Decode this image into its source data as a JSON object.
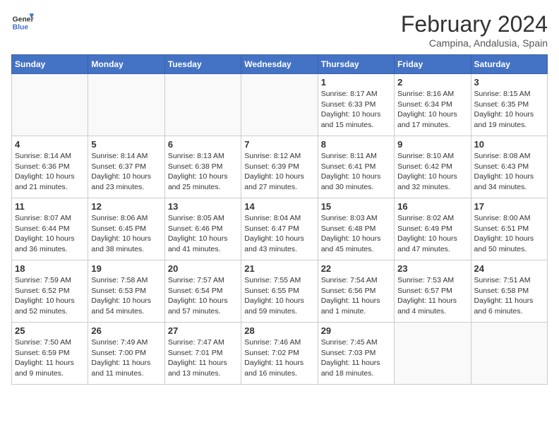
{
  "header": {
    "logo_general": "General",
    "logo_blue": "Blue",
    "month_title": "February 2024",
    "location": "Campina, Andalusia, Spain"
  },
  "weekdays": [
    "Sunday",
    "Monday",
    "Tuesday",
    "Wednesday",
    "Thursday",
    "Friday",
    "Saturday"
  ],
  "weeks": [
    [
      {
        "day": "",
        "info": ""
      },
      {
        "day": "",
        "info": ""
      },
      {
        "day": "",
        "info": ""
      },
      {
        "day": "",
        "info": ""
      },
      {
        "day": "1",
        "info": "Sunrise: 8:17 AM\nSunset: 6:33 PM\nDaylight: 10 hours\nand 15 minutes."
      },
      {
        "day": "2",
        "info": "Sunrise: 8:16 AM\nSunset: 6:34 PM\nDaylight: 10 hours\nand 17 minutes."
      },
      {
        "day": "3",
        "info": "Sunrise: 8:15 AM\nSunset: 6:35 PM\nDaylight: 10 hours\nand 19 minutes."
      }
    ],
    [
      {
        "day": "4",
        "info": "Sunrise: 8:14 AM\nSunset: 6:36 PM\nDaylight: 10 hours\nand 21 minutes."
      },
      {
        "day": "5",
        "info": "Sunrise: 8:14 AM\nSunset: 6:37 PM\nDaylight: 10 hours\nand 23 minutes."
      },
      {
        "day": "6",
        "info": "Sunrise: 8:13 AM\nSunset: 6:38 PM\nDaylight: 10 hours\nand 25 minutes."
      },
      {
        "day": "7",
        "info": "Sunrise: 8:12 AM\nSunset: 6:39 PM\nDaylight: 10 hours\nand 27 minutes."
      },
      {
        "day": "8",
        "info": "Sunrise: 8:11 AM\nSunset: 6:41 PM\nDaylight: 10 hours\nand 30 minutes."
      },
      {
        "day": "9",
        "info": "Sunrise: 8:10 AM\nSunset: 6:42 PM\nDaylight: 10 hours\nand 32 minutes."
      },
      {
        "day": "10",
        "info": "Sunrise: 8:08 AM\nSunset: 6:43 PM\nDaylight: 10 hours\nand 34 minutes."
      }
    ],
    [
      {
        "day": "11",
        "info": "Sunrise: 8:07 AM\nSunset: 6:44 PM\nDaylight: 10 hours\nand 36 minutes."
      },
      {
        "day": "12",
        "info": "Sunrise: 8:06 AM\nSunset: 6:45 PM\nDaylight: 10 hours\nand 38 minutes."
      },
      {
        "day": "13",
        "info": "Sunrise: 8:05 AM\nSunset: 6:46 PM\nDaylight: 10 hours\nand 41 minutes."
      },
      {
        "day": "14",
        "info": "Sunrise: 8:04 AM\nSunset: 6:47 PM\nDaylight: 10 hours\nand 43 minutes."
      },
      {
        "day": "15",
        "info": "Sunrise: 8:03 AM\nSunset: 6:48 PM\nDaylight: 10 hours\nand 45 minutes."
      },
      {
        "day": "16",
        "info": "Sunrise: 8:02 AM\nSunset: 6:49 PM\nDaylight: 10 hours\nand 47 minutes."
      },
      {
        "day": "17",
        "info": "Sunrise: 8:00 AM\nSunset: 6:51 PM\nDaylight: 10 hours\nand 50 minutes."
      }
    ],
    [
      {
        "day": "18",
        "info": "Sunrise: 7:59 AM\nSunset: 6:52 PM\nDaylight: 10 hours\nand 52 minutes."
      },
      {
        "day": "19",
        "info": "Sunrise: 7:58 AM\nSunset: 6:53 PM\nDaylight: 10 hours\nand 54 minutes."
      },
      {
        "day": "20",
        "info": "Sunrise: 7:57 AM\nSunset: 6:54 PM\nDaylight: 10 hours\nand 57 minutes."
      },
      {
        "day": "21",
        "info": "Sunrise: 7:55 AM\nSunset: 6:55 PM\nDaylight: 10 hours\nand 59 minutes."
      },
      {
        "day": "22",
        "info": "Sunrise: 7:54 AM\nSunset: 6:56 PM\nDaylight: 11 hours\nand 1 minute."
      },
      {
        "day": "23",
        "info": "Sunrise: 7:53 AM\nSunset: 6:57 PM\nDaylight: 11 hours\nand 4 minutes."
      },
      {
        "day": "24",
        "info": "Sunrise: 7:51 AM\nSunset: 6:58 PM\nDaylight: 11 hours\nand 6 minutes."
      }
    ],
    [
      {
        "day": "25",
        "info": "Sunrise: 7:50 AM\nSunset: 6:59 PM\nDaylight: 11 hours\nand 9 minutes."
      },
      {
        "day": "26",
        "info": "Sunrise: 7:49 AM\nSunset: 7:00 PM\nDaylight: 11 hours\nand 11 minutes."
      },
      {
        "day": "27",
        "info": "Sunrise: 7:47 AM\nSunset: 7:01 PM\nDaylight: 11 hours\nand 13 minutes."
      },
      {
        "day": "28",
        "info": "Sunrise: 7:46 AM\nSunset: 7:02 PM\nDaylight: 11 hours\nand 16 minutes."
      },
      {
        "day": "29",
        "info": "Sunrise: 7:45 AM\nSunset: 7:03 PM\nDaylight: 11 hours\nand 18 minutes."
      },
      {
        "day": "",
        "info": ""
      },
      {
        "day": "",
        "info": ""
      }
    ]
  ]
}
